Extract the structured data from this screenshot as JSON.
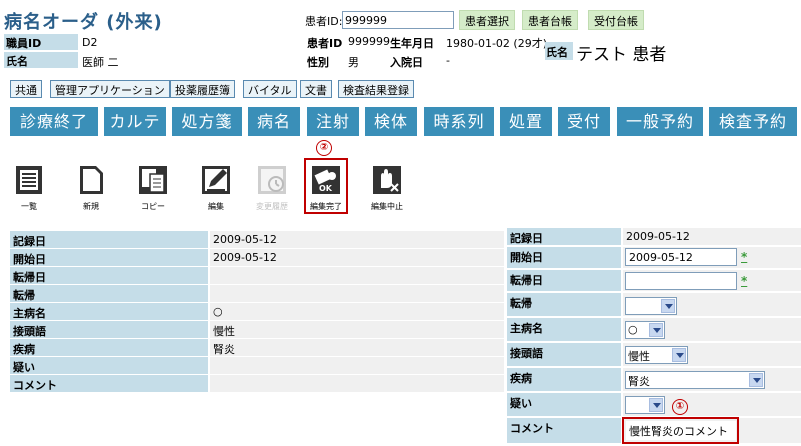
{
  "header": {
    "title": "病名オーダ (外来)",
    "staff_id_label": "職員ID",
    "staff_id": "D2",
    "staff_name_label": "氏名",
    "staff_name": "医師 二"
  },
  "patient": {
    "search_label": "患者ID:",
    "search_value": "999999",
    "buttons": [
      "患者選択",
      "患者台帳",
      "受付台帳"
    ],
    "id_label": "患者ID",
    "id": "999999",
    "birth_label": "生年月日",
    "birth": "1980-01-02 (29才)",
    "sex_label": "性別",
    "sex": "男",
    "admission_label": "入院日",
    "admission": "-",
    "name_label": "氏名",
    "name": "テスト 患者"
  },
  "sub_tabs": [
    "共通",
    "管理アプリケーション",
    "投薬履歴簿",
    "バイタル",
    "文書",
    "検査結果登録"
  ],
  "main_buttons": [
    "診療終了",
    "カルテ",
    "処方箋",
    "病名",
    "注射",
    "検体",
    "時系列",
    "処置",
    "受付",
    "一般予約",
    "検査予約"
  ],
  "toolbar": {
    "items": [
      "一覧",
      "新規",
      "コピー",
      "編集",
      "変更履歴",
      "編集完了",
      "編集中止"
    ],
    "annotation": "②"
  },
  "detail": {
    "rows": [
      {
        "label": "記録日",
        "value": "2009-05-12"
      },
      {
        "label": "開始日",
        "value": "2009-05-12"
      },
      {
        "label": "転帰日",
        "value": ""
      },
      {
        "label": "転帰",
        "value": ""
      },
      {
        "label": "主病名",
        "value": "○"
      },
      {
        "label": "接頭語",
        "value": "慢性"
      },
      {
        "label": "疾病",
        "value": "腎炎"
      },
      {
        "label": "疑い",
        "value": ""
      },
      {
        "label": "コメント",
        "value": ""
      }
    ]
  },
  "form": {
    "record_date_label": "記録日",
    "record_date": "2009-05-12",
    "start_date_label": "開始日",
    "start_date": "2009-05-12",
    "outcome_date_label": "転帰日",
    "outcome_date": "",
    "outcome_label": "転帰",
    "outcome": "",
    "main_label": "主病名",
    "main_value": "○",
    "prefix_label": "接頭語",
    "prefix_value": "慢性",
    "disease_label": "疾病",
    "disease_value": "腎炎",
    "suspect_label": "疑い",
    "suspect_value": "",
    "comment_label": "コメント",
    "comment_value": "慢性腎炎のコメント",
    "required_mark": "*",
    "annotation": "①"
  },
  "colors": {
    "title": "#2b5f8a",
    "label_bg": "#c5dde8",
    "main_button_bg": "#3a8fb8",
    "green_button_bg": "#d5ecc9",
    "highlight": "#c00000"
  }
}
